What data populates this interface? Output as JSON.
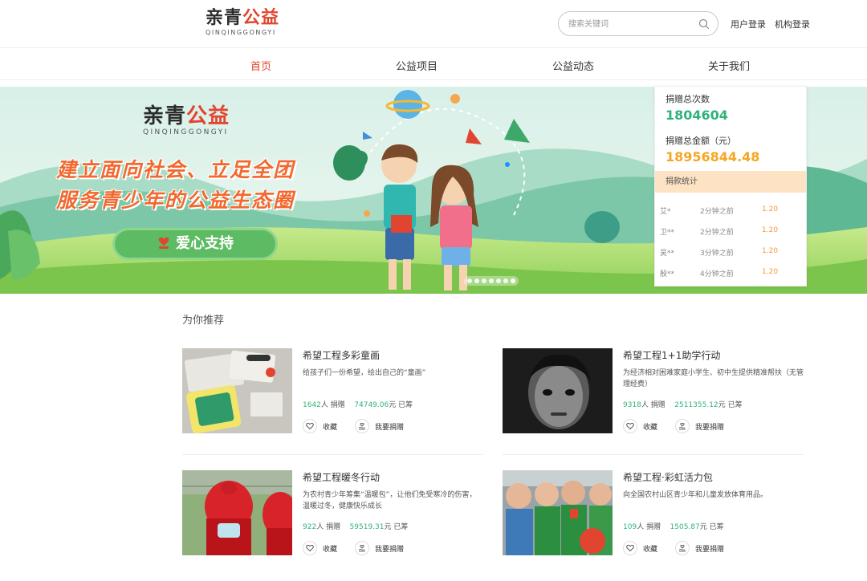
{
  "header": {
    "logo_main_1": "亲青",
    "logo_main_2": "公益",
    "logo_sub": "QINQINGGONGYI",
    "search_placeholder": "搜索关键词",
    "user_login": "用户登录",
    "org_login": "机构登录"
  },
  "nav": {
    "items": [
      {
        "label": "首页",
        "active": true
      },
      {
        "label": "公益项目",
        "active": false
      },
      {
        "label": "公益动态",
        "active": false
      },
      {
        "label": "关于我们",
        "active": false
      }
    ]
  },
  "banner": {
    "logo_main_1": "亲青",
    "logo_main_2": "公益",
    "logo_sub": "QINQINGGONGYI",
    "slogan_line1": "建立面向社会、立足全团",
    "slogan_line2": "服务青少年的公益生态圈",
    "button_label": "爱心支持",
    "slide_count": 7,
    "active_slide": 7
  },
  "stats": {
    "count_label": "捐赠总次数",
    "count_value": "1804604",
    "amount_label": "捐赠总金额（元）",
    "amount_value": "18956844.48",
    "list_title": "捐款统计",
    "donations": [
      {
        "name": "艾*",
        "time": "2分钟之前",
        "amount": "1.20"
      },
      {
        "name": "卫**",
        "time": "2分钟之前",
        "amount": "1.20"
      },
      {
        "name": "吴**",
        "time": "3分钟之前",
        "amount": "1.20"
      },
      {
        "name": "殷**",
        "time": "4分钟之前",
        "amount": "1.20"
      }
    ]
  },
  "recommend": {
    "title": "为你推荐",
    "fav_label": "收藏",
    "donate_label": "我要捐赠",
    "people_unit": "人",
    "donate_unit": "捐赠",
    "yuan_unit": "元",
    "raised_unit": "已筹",
    "cards": [
      {
        "title": "希望工程多彩童画",
        "desc": "给孩子们一份希望，绘出自己的“童画”",
        "donors": "1642",
        "amount": "74749.06"
      },
      {
        "title": "希望工程1+1助学行动",
        "desc": "为经济相对困难家庭小学生、初中生提供精准帮扶（无管理经费）",
        "donors": "9318",
        "amount": "2511355.12"
      },
      {
        "title": "希望工程暖冬行动",
        "desc": "为农村青少年筹集“温暖包”，让他们免受寒冷的伤害，温暖过冬，健康快乐成长",
        "donors": "922",
        "amount": "59519.31"
      },
      {
        "title": "希望工程·彩虹活力包",
        "desc": "向全国农村山区青少年和儿童发放体育用品。",
        "donors": "109",
        "amount": "1505.87"
      }
    ]
  },
  "colors": {
    "accent_red": "#e2452f",
    "stat_green": "#2fb37a",
    "stat_orange": "#f5a623",
    "donation_orange": "#f29a3a"
  }
}
